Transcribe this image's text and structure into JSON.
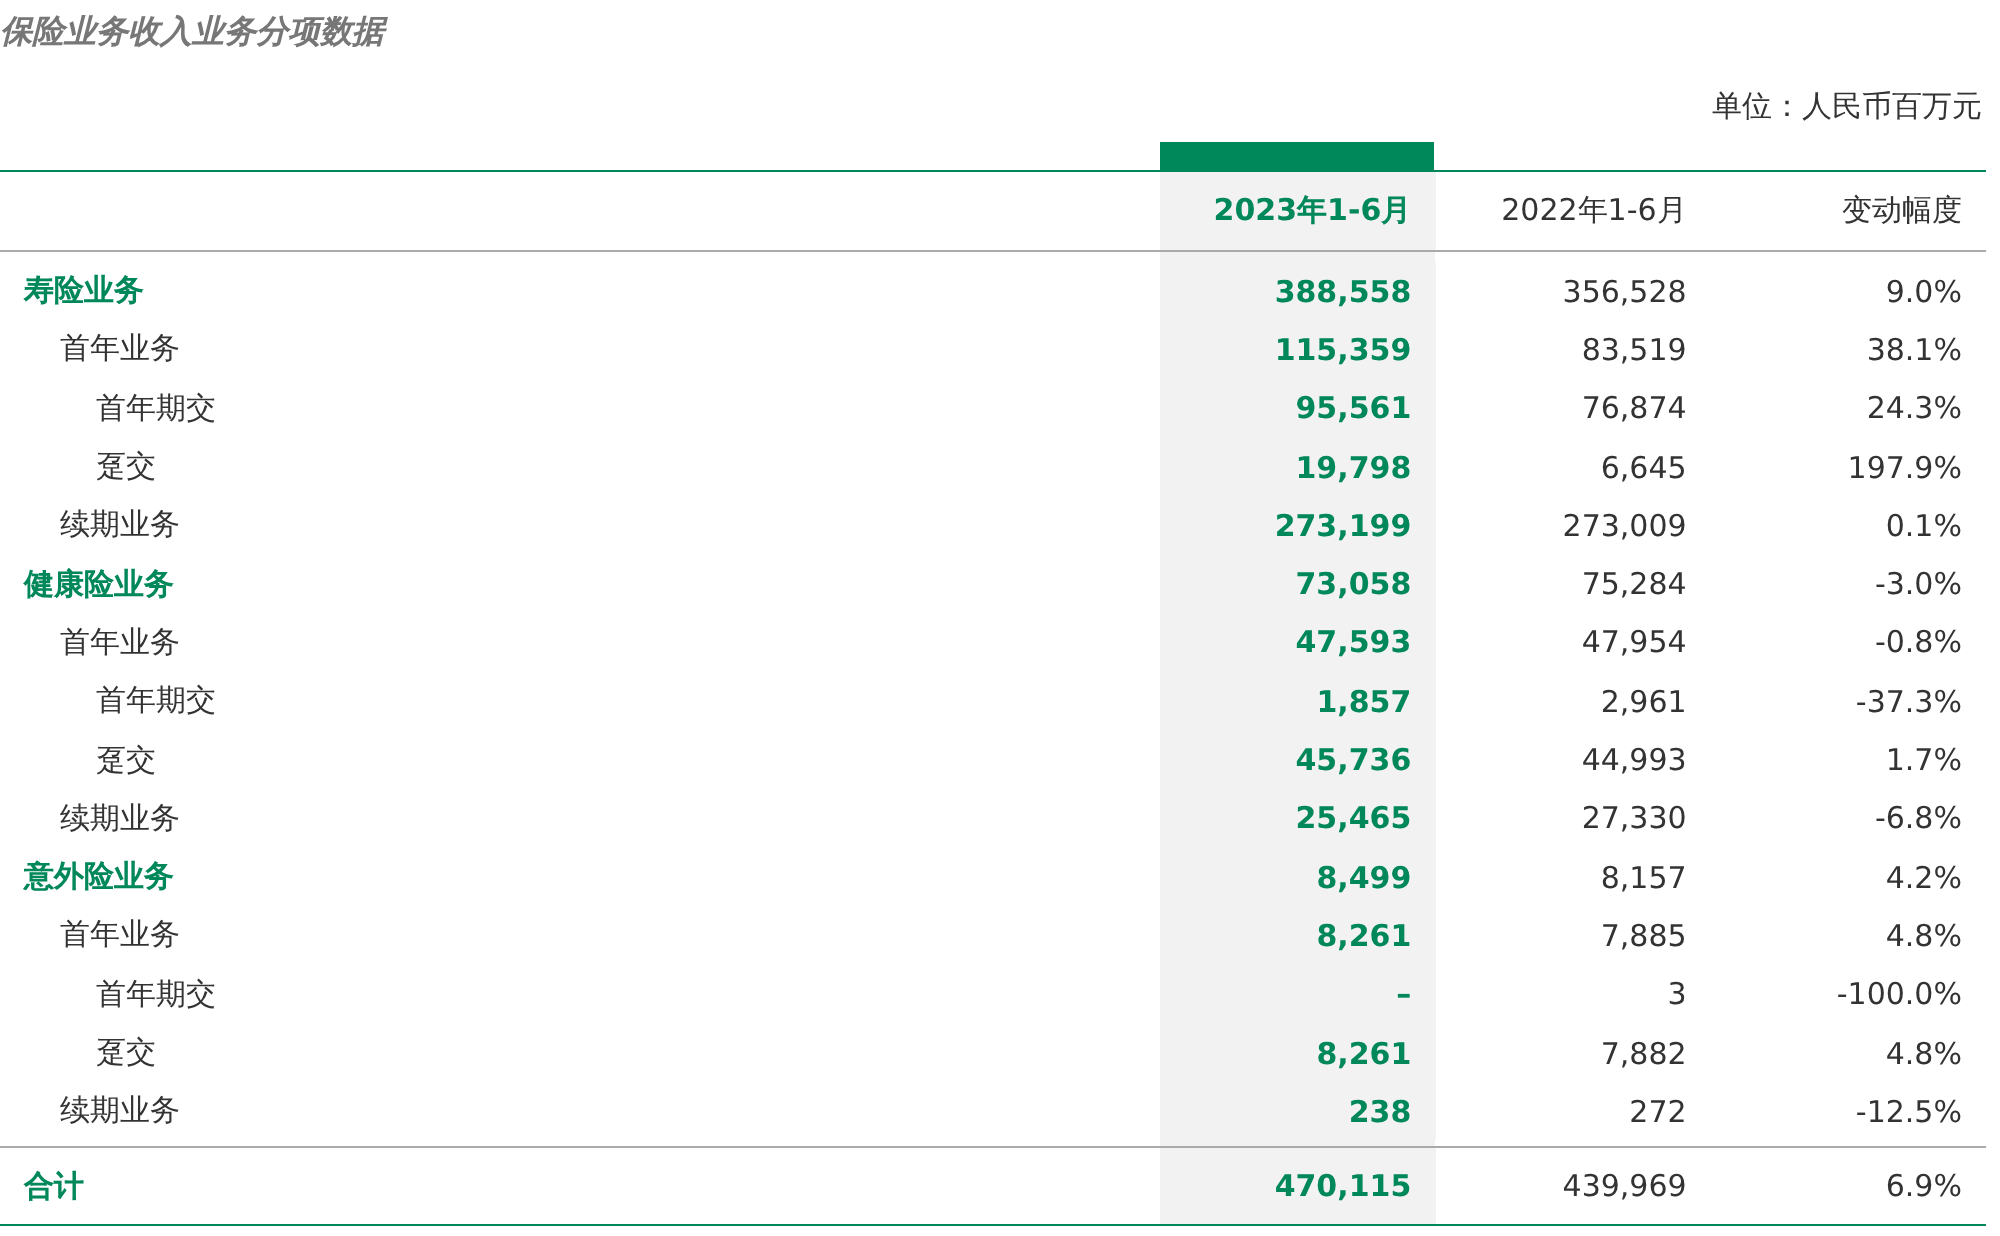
{
  "title": "保险业务收入业务分项数据",
  "unit": "单位：人民币百万元",
  "columns": [
    "2023年1-6月",
    "2022年1-6月",
    "变动幅度"
  ],
  "rows": [
    {
      "label": "寿险业务",
      "values": [
        "388,558",
        "356,528",
        "9.0%"
      ],
      "children": [
        {
          "label": "首年业务",
          "values": [
            "115,359",
            "83,519",
            "38.1%"
          ],
          "children": [
            {
              "label": "首年期交",
              "values": [
                "95,561",
                "76,874",
                "24.3%"
              ]
            },
            {
              "label": "趸交",
              "values": [
                "19,798",
                "6,645",
                "197.9%"
              ]
            }
          ]
        },
        {
          "label": "续期业务",
          "values": [
            "273,199",
            "273,009",
            "0.1%"
          ]
        }
      ]
    },
    {
      "label": "健康险业务",
      "values": [
        "73,058",
        "75,284",
        "-3.0%"
      ],
      "children": [
        {
          "label": "首年业务",
          "values": [
            "47,593",
            "47,954",
            "-0.8%"
          ],
          "children": [
            {
              "label": "首年期交",
              "values": [
                "1,857",
                "2,961",
                "-37.3%"
              ]
            },
            {
              "label": "趸交",
              "values": [
                "45,736",
                "44,993",
                "1.7%"
              ]
            }
          ]
        },
        {
          "label": "续期业务",
          "values": [
            "25,465",
            "27,330",
            "-6.8%"
          ]
        }
      ]
    },
    {
      "label": "意外险业务",
      "values": [
        "8,499",
        "8,157",
        "4.2%"
      ],
      "children": [
        {
          "label": "首年业务",
          "values": [
            "8,261",
            "7,885",
            "4.8%"
          ],
          "children": [
            {
              "label": "首年期交",
              "values": [
                "–",
                "3",
                "-100.0%"
              ]
            },
            {
              "label": "趸交",
              "values": [
                "8,261",
                "7,882",
                "4.8%"
              ]
            }
          ]
        },
        {
          "label": "续期业务",
          "values": [
            "238",
            "272",
            "-12.5%"
          ]
        }
      ]
    }
  ],
  "total": {
    "label": "合计",
    "values": [
      "470,115",
      "439,969",
      "6.9%"
    ]
  }
}
